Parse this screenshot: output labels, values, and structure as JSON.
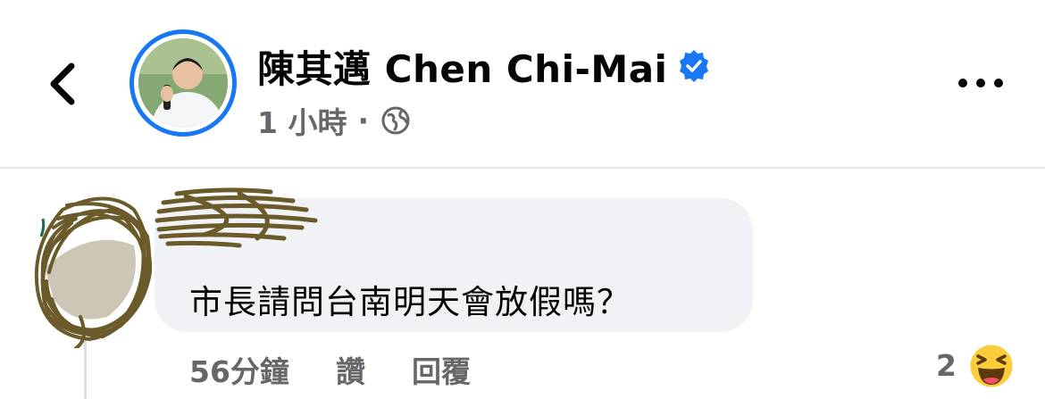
{
  "header": {
    "page_name": "陳其邁 Chen Chi-Mai",
    "verified": true,
    "time": "1 小時",
    "separator": "·",
    "audience_icon": "globe-icon",
    "back_icon": "chevron-left-icon",
    "more_icon": "more-horizontal-icon"
  },
  "comment": {
    "text": "市長請問台南明天會放假嗎？",
    "time": "56分鐘",
    "like_label": "讚",
    "reply_label": "回覆",
    "reaction_count": "2",
    "reaction_icon": "haha-emoji-icon"
  },
  "colors": {
    "accent": "#1877f2",
    "bubble": "#f0f2f5",
    "meta_text": "#65676b",
    "scribble": "#6b5b2a"
  }
}
